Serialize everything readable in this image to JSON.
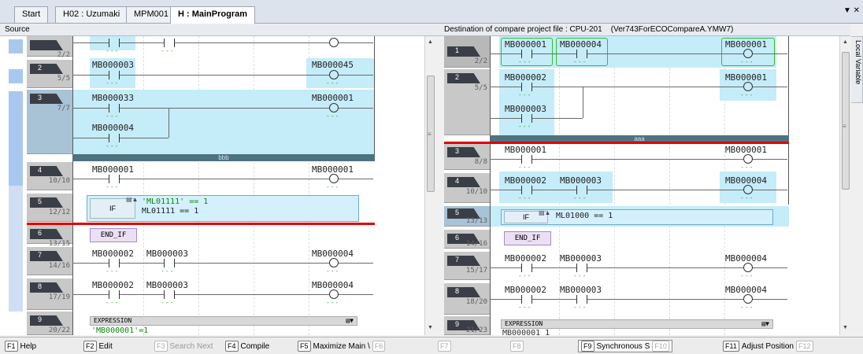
{
  "tabs": [
    "Start",
    "H02 : Uzumaki",
    "MPM001",
    "H : MainProgram"
  ],
  "tab_menu_icon": "dropdown-close-icon",
  "left_title": "Source",
  "right_title": "Destination of compare project file : CPU-201",
  "right_version": "(Ver743ForECOCompareA.YMW7)",
  "side_panel_label": "Local Variable",
  "left": {
    "rows": [
      {
        "num": "",
        "step": "2/2"
      },
      {
        "num": "2",
        "step": "5/5"
      },
      {
        "num": "3",
        "step": "7/7"
      },
      {
        "num": "4",
        "step": "10/10"
      },
      {
        "num": "5",
        "step": "12/12"
      },
      {
        "num": "6",
        "step": "13/15"
      },
      {
        "num": "7",
        "step": "14/16"
      },
      {
        "num": "8",
        "step": "17/19"
      },
      {
        "num": "9",
        "step": "20/22"
      }
    ],
    "labels": {
      "r2c1": "MB000003",
      "r2coil": "MB000045",
      "r3c1": "MB000033",
      "r3coil": "MB000001",
      "r3c2": "MB000004",
      "sep": "bbb",
      "r4c1": "MB000001",
      "r4coil": "MB000001",
      "if": "IF",
      "expr1": "'ML01111' == 1",
      "expr2": "ML01111 == 1",
      "endif": "END_IF",
      "r7c1": "MB000002",
      "r7c2": "MB000003",
      "r7coil": "MB000004",
      "r8c1": "MB000002",
      "r8c2": "MB000003",
      "r8coil": "MB000004",
      "exprhead": "EXPRESSION",
      "exprtext": "'MB000001'=1"
    }
  },
  "right": {
    "rows": [
      {
        "num": "1",
        "step": "2/2"
      },
      {
        "num": "2",
        "step": "5/5"
      },
      {
        "num": "3",
        "step": "8/8"
      },
      {
        "num": "4",
        "step": "10/10"
      },
      {
        "num": "5",
        "step": "13/13"
      },
      {
        "num": "6",
        "step": "14/16"
      },
      {
        "num": "7",
        "step": "15/17"
      },
      {
        "num": "8",
        "step": "18/20"
      },
      {
        "num": "9",
        "step": "21/23"
      }
    ],
    "labels": {
      "r1c1": "MB000001",
      "r1c2": "MB000004",
      "r1coil": "MB000001",
      "r2c1": "MB000002",
      "r2coil": "MB000001",
      "r2c2": "MB000003",
      "sep": "aaa",
      "r3c1": "MB000001",
      "r3coil": "MB000001",
      "r4c1": "MB000002",
      "r4c2": "MB000003",
      "r4coil": "MB000004",
      "if": "IF",
      "expr": "ML01000 == 1",
      "endif": "END_IF",
      "r7c1": "MB000002",
      "r7c2": "MB000003",
      "r7coil": "MB000004",
      "r8c1": "MB000002",
      "r8c2": "MB000003",
      "r8coil": "MB000004",
      "exprhead": "EXPRESSION",
      "exprtext": "MB000001 1"
    }
  },
  "fkeys": [
    {
      "key": "F1",
      "label": "Help"
    },
    {
      "key": "F2",
      "label": "Edit"
    },
    {
      "key": "F3",
      "label": "Search Next"
    },
    {
      "key": "F4",
      "label": "Compile"
    },
    {
      "key": "F5",
      "label": "Maximize Main \\",
      "key2": "F6"
    },
    {
      "key": "F7",
      "label": ""
    },
    {
      "key": "F8",
      "label": ""
    },
    {
      "key": "F9",
      "label": "Synchronous S",
      "key2": "F10"
    },
    {
      "key": "F11",
      "label": "Adjust Position",
      "key2": "F12"
    }
  ]
}
